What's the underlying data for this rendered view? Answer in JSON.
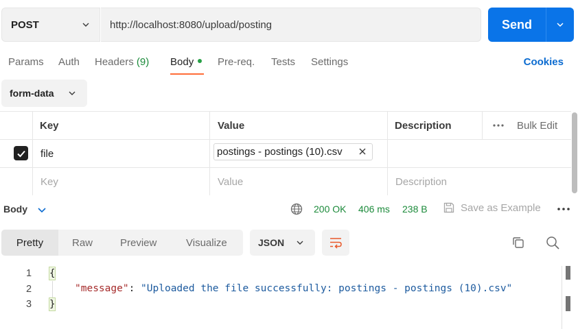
{
  "request": {
    "method": "POST",
    "url": "http://localhost:8080/upload/posting",
    "send_label": "Send"
  },
  "tabs": [
    {
      "label": "Params"
    },
    {
      "label": "Auth"
    },
    {
      "label": "Headers",
      "count": "(9)"
    },
    {
      "label": "Body",
      "active": true
    },
    {
      "label": "Pre-req."
    },
    {
      "label": "Tests"
    },
    {
      "label": "Settings"
    }
  ],
  "cookies_label": "Cookies",
  "body_mode": "form-data",
  "params_table": {
    "headers": [
      "Key",
      "Value",
      "Description"
    ],
    "bulk_edit_label": "Bulk Edit",
    "rows": [
      {
        "checked": true,
        "key": "file",
        "value": "postings - postings (10).csv",
        "description": ""
      }
    ],
    "placeholder": {
      "key": "Key",
      "value": "Value",
      "description": "Description"
    }
  },
  "response": {
    "section_label": "Body",
    "status": "200 OK",
    "time": "406 ms",
    "size": "238 B",
    "save_example_label": "Save as Example",
    "view_tabs": [
      "Pretty",
      "Raw",
      "Preview",
      "Visualize"
    ],
    "active_view": "Pretty",
    "format": "JSON",
    "code_lines": {
      "line_numbers": [
        "1",
        "2",
        "3"
      ],
      "open_brace": "{",
      "close_brace": "}",
      "key": "\"message\"",
      "colon": ": ",
      "value": "\"Uploaded the file successfully: postings - postings (10).csv\""
    }
  },
  "colors": {
    "send": "#0a74e8",
    "active_tab_underline": "#ff6c37",
    "status_ok": "#1b8a3a",
    "link": "#0b6bd0"
  },
  "icons": [
    "chevron-down-icon",
    "globe-icon",
    "save-icon",
    "more-icon",
    "wrap-icon",
    "copy-icon",
    "search-icon",
    "check-icon",
    "close-icon"
  ]
}
